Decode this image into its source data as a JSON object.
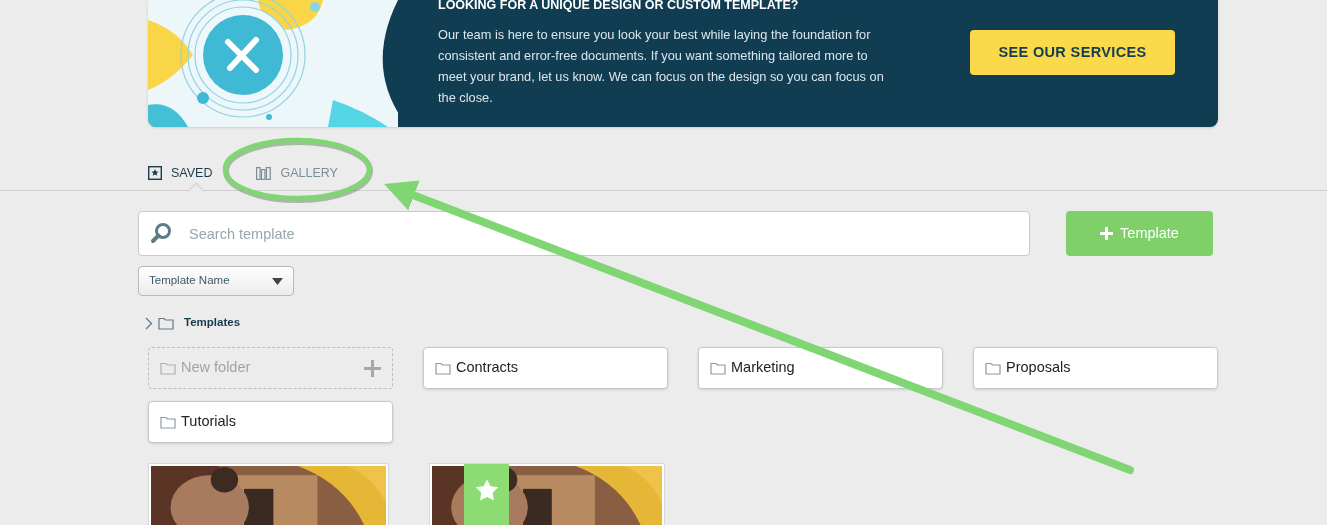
{
  "banner": {
    "heading": "LOOKING FOR A UNIQUE DESIGN OR CUSTOM TEMPLATE?",
    "body": "Our team is here to ensure you look your best while laying the foundation for consistent and error-free documents. If you want something tailored more to meet your brand, let us know. We can focus on the design so you can focus on the close.",
    "button": "SEE OUR SERVICES"
  },
  "tabs": [
    {
      "label": "SAVED",
      "kind": "saved",
      "selected": true
    },
    {
      "label": "GALLERY",
      "kind": "gallery",
      "selected": false
    }
  ],
  "search": {
    "placeholder": "Search template"
  },
  "add_button": {
    "label": "Template"
  },
  "sort_select": {
    "value": "Template Name"
  },
  "tree": {
    "label": "Templates",
    "expanded": false
  },
  "folders": [
    {
      "kind": "new",
      "label": "New folder"
    },
    {
      "kind": "folder",
      "label": "Contracts"
    },
    {
      "kind": "folder",
      "label": "Marketing"
    },
    {
      "kind": "folder",
      "label": "Proposals"
    },
    {
      "kind": "folder",
      "label": "Tutorials"
    }
  ],
  "thumbnails": [
    {
      "kind": "picture",
      "starred": false
    },
    {
      "kind": "picture",
      "starred": true
    }
  ]
}
